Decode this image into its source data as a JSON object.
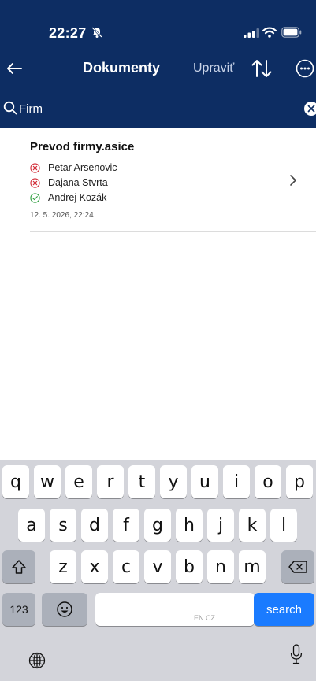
{
  "status_bar": {
    "time": "22:27"
  },
  "nav": {
    "title": "Dokumenty",
    "edit_label": "Upraviť"
  },
  "search": {
    "value": "Firm"
  },
  "documents": [
    {
      "title": "Prevod firmy.asice",
      "signers": [
        {
          "name": "Petar Arsenovic",
          "status": "rejected"
        },
        {
          "name": "Dajana Stvrta",
          "status": "rejected"
        },
        {
          "name": "Andrej Kozák",
          "status": "signed"
        }
      ],
      "date": "12. 5. 2026, 22:24"
    }
  ],
  "keyboard": {
    "row1": [
      "q",
      "w",
      "e",
      "r",
      "t",
      "y",
      "u",
      "i",
      "o",
      "p"
    ],
    "row2": [
      "a",
      "s",
      "d",
      "f",
      "g",
      "h",
      "j",
      "k",
      "l"
    ],
    "row3": [
      "z",
      "x",
      "c",
      "v",
      "b",
      "n",
      "m"
    ],
    "numbers_label": "123",
    "space_lang": "EN CZ",
    "action_label": "search"
  },
  "colors": {
    "header": "#0d2d63",
    "rejected": "#d32f3a",
    "signed": "#2e9e3e",
    "keyboard_bg": "#d3d4da",
    "action_key": "#1a7bff"
  }
}
